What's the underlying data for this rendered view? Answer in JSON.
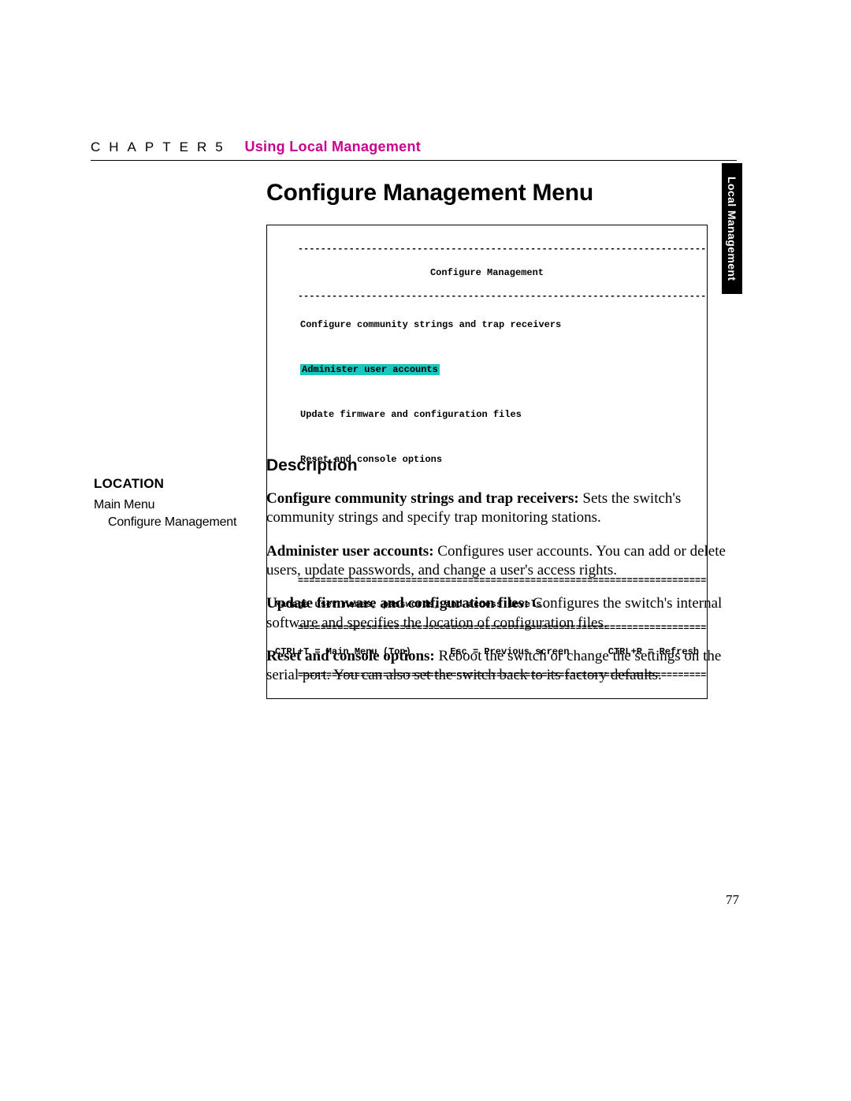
{
  "header": {
    "chapter_word": "CHAPTER",
    "chapter_num": "5",
    "chapter_title": "Using Local Management"
  },
  "side_tab": "Local Management",
  "page_title": "Configure Management Menu",
  "terminal": {
    "dash_line": "------------------------------------------------------------------------------",
    "title": "Configure Management",
    "items": {
      "i1": "Configure community strings and trap receivers",
      "i2": "Administer user accounts",
      "i3": "Update firmware and configuration files",
      "i4": "Reset and console options"
    },
    "eq_line": "==============================================================================",
    "status": "Manage user names, passwords, and access levels.",
    "footer": {
      "f1": "CTRL+T = Main Menu (Top)",
      "f2": "Esc = Previous screen",
      "f3": "CTRL+R = Refresh"
    }
  },
  "location": {
    "head": "LOCATION",
    "l1": "Main Menu",
    "l2": "Configure Management"
  },
  "description": {
    "head": "Description",
    "p1_lead": "Configure community strings and trap receivers:",
    "p1_rest": " Sets the switch's community strings and specify trap monitoring stations.",
    "p2_lead": "Administer user accounts:",
    "p2_rest": " Configures user accounts. You can add or delete users, update passwords, and change a user's access rights.",
    "p3_lead": "Update firmware and configuration files:",
    "p3_rest": " Configures the switch's internal software and specifies the location of configuration files.",
    "p4_lead": "Reset and console options:",
    "p4_rest": " Reboot the switch or change the settings on the serial port. You can also set the switch back to its factory defaults."
  },
  "page_number": "77"
}
